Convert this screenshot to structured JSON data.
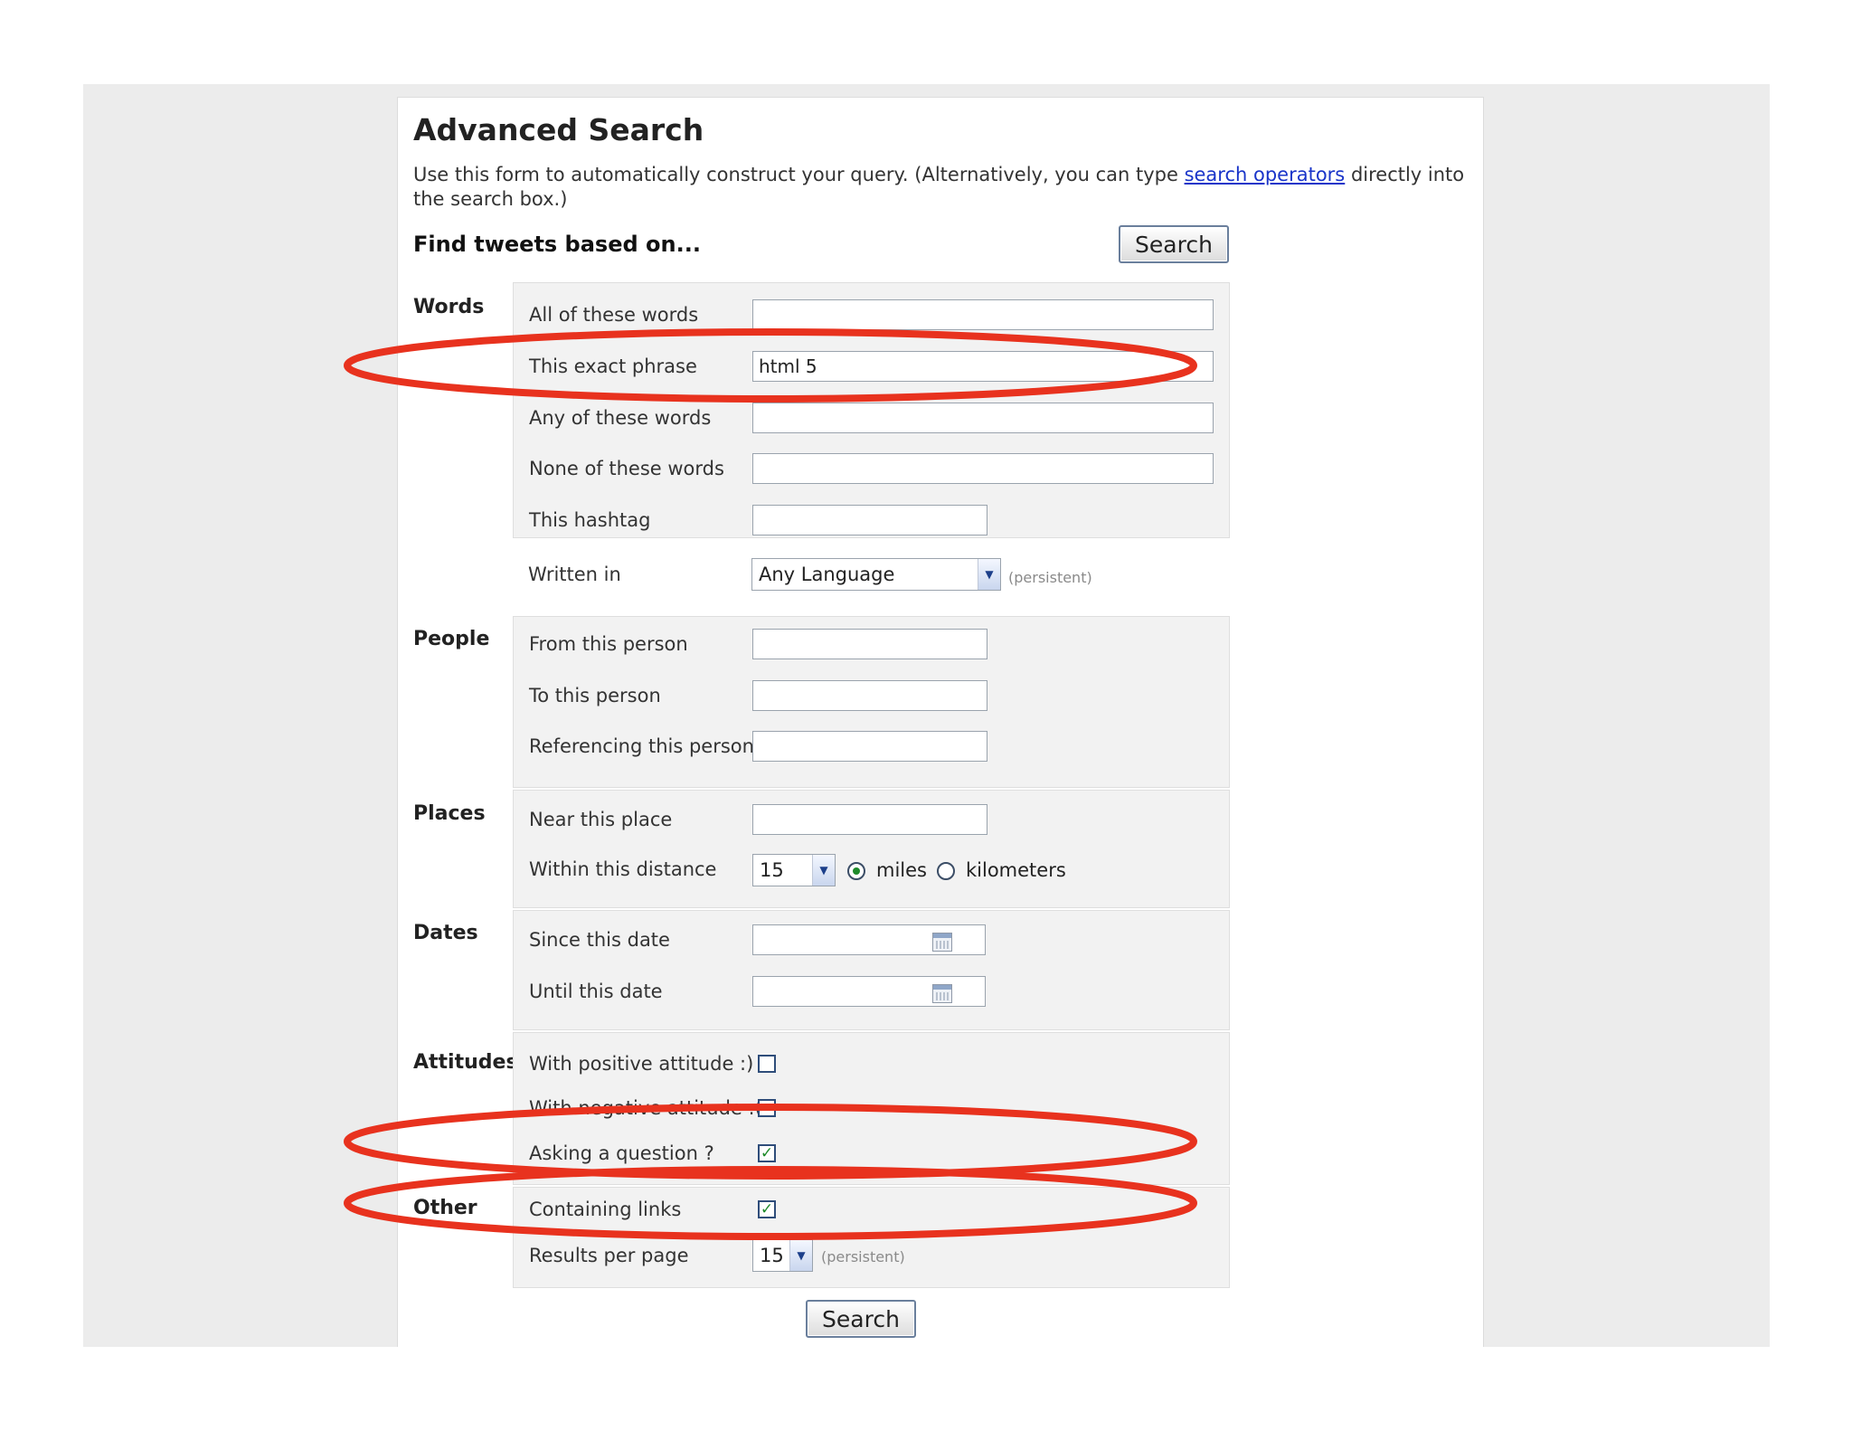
{
  "page": {
    "title": "Advanced Search",
    "intro_before": "Use this form to automatically construct your query. (Alternatively, you can type ",
    "intro_link": "search operators",
    "intro_after": " directly into the search box.)",
    "find_title": "Find tweets based on...",
    "search_label": "Search"
  },
  "groups": {
    "words": {
      "label": "Words",
      "all_label": "All of these words",
      "all_value": "",
      "phrase_label": "This exact phrase",
      "phrase_value": "html 5",
      "any_label": "Any of these words",
      "any_value": "",
      "none_label": "None of these words",
      "none_value": "",
      "hashtag_label": "This hashtag",
      "hashtag_value": "",
      "lang_label": "Written in",
      "lang_value": "Any Language",
      "lang_note": "(persistent)"
    },
    "people": {
      "label": "People",
      "from_label": "From this person",
      "from_value": "",
      "to_label": "To this person",
      "to_value": "",
      "ref_label": "Referencing this person",
      "ref_value": ""
    },
    "places": {
      "label": "Places",
      "near_label": "Near this place",
      "near_value": "",
      "distance_label": "Within this distance",
      "distance_value": "15",
      "unit_miles": "miles",
      "unit_km": "kilometers",
      "selected_unit": "miles"
    },
    "dates": {
      "label": "Dates",
      "since_label": "Since this date",
      "since_value": "",
      "until_label": "Until this date",
      "until_value": ""
    },
    "attitudes": {
      "label": "Attitudes",
      "positive_label": "With positive attitude :)",
      "positive_checked": false,
      "negative_label": "With negative attitude :(",
      "negative_checked": false,
      "question_label": "Asking a question ?",
      "question_checked": true
    },
    "other": {
      "label": "Other",
      "links_label": "Containing links",
      "links_checked": true,
      "rpp_label": "Results per page",
      "rpp_value": "15",
      "rpp_note": "(persistent)"
    }
  },
  "colors": {
    "annotation": "#e8321e",
    "link": "#1a35c9",
    "check": "#1e8a2a"
  },
  "icons": {
    "checkmark": "✓",
    "dropdown_arrow": "▼"
  }
}
